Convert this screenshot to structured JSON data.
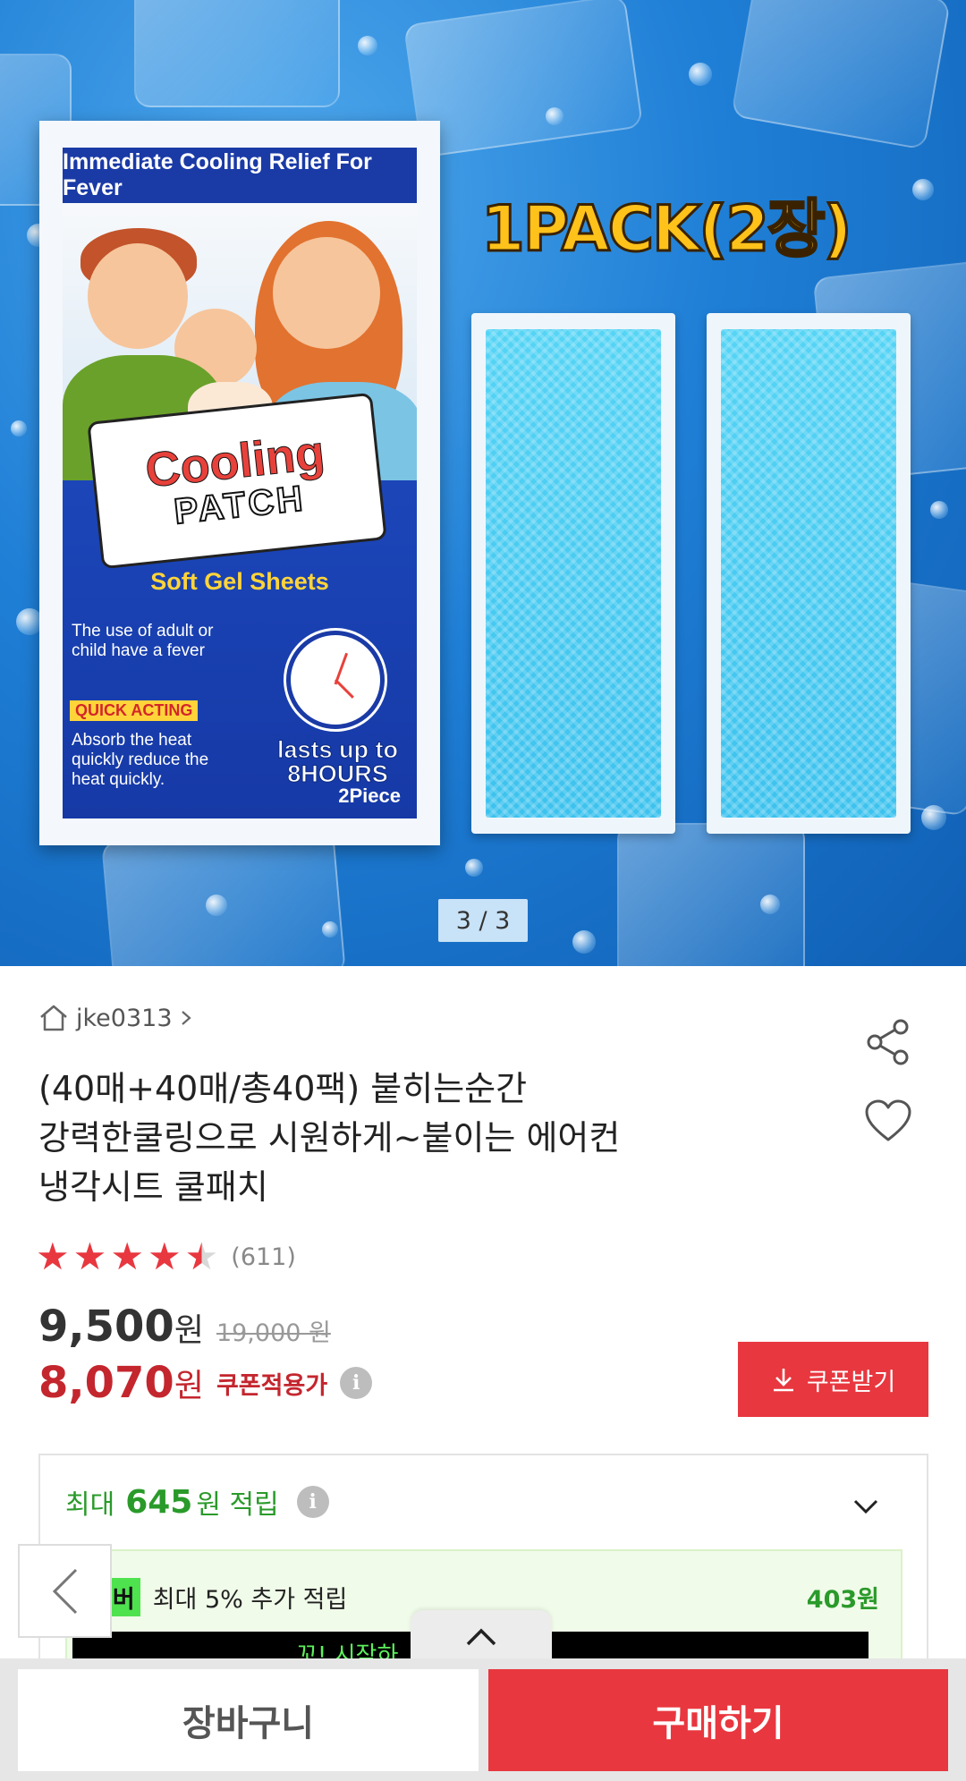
{
  "image": {
    "pack_header": "Immediate Cooling Relief For Fever",
    "logo_line1": "Cooling",
    "logo_line2": "PATCH",
    "subtitle": "Soft Gel Sheets",
    "usage_text": "The use of adult or child have a fever",
    "quick_acting": "QUICK ACTING",
    "absorb_text": "Absorb the heat quickly reduce the heat quickly.",
    "lasts_line1": "lasts up to",
    "lasts_line2": "8HOURS",
    "piece": "2Piece",
    "promo_title": "1PACK(2장)",
    "counter": "3 / 3"
  },
  "seller": {
    "name": "jke0313"
  },
  "product": {
    "title_line1": "(40매+40매/총40팩) 붙히는순간",
    "title_line2": "강력한쿨링으로 시원하게~붙이는 에어컨",
    "title_line3": "냉각시트 쿨패치",
    "rating": 4.5,
    "review_count": "(611)",
    "price": "9,500",
    "price_unit": "원",
    "original_price": "19,000 원",
    "coupon_price": "8,070",
    "coupon_price_unit": "원",
    "coupon_label": "쿠폰적용가",
    "coupon_button": "쿠폰받기"
  },
  "points": {
    "prefix": "최대",
    "amount": "645",
    "suffix": "원 적립",
    "member_badge": "멤버",
    "member_text": "최대 5% 추가 적립",
    "member_amount": "403원",
    "banner_text": "꼬! 시작하 ... 받기 >"
  },
  "bottom": {
    "cart": "장바구니",
    "buy": "구매하기"
  },
  "colors": {
    "accent_red": "#e8373f",
    "points_green": "#2a9a2a"
  }
}
